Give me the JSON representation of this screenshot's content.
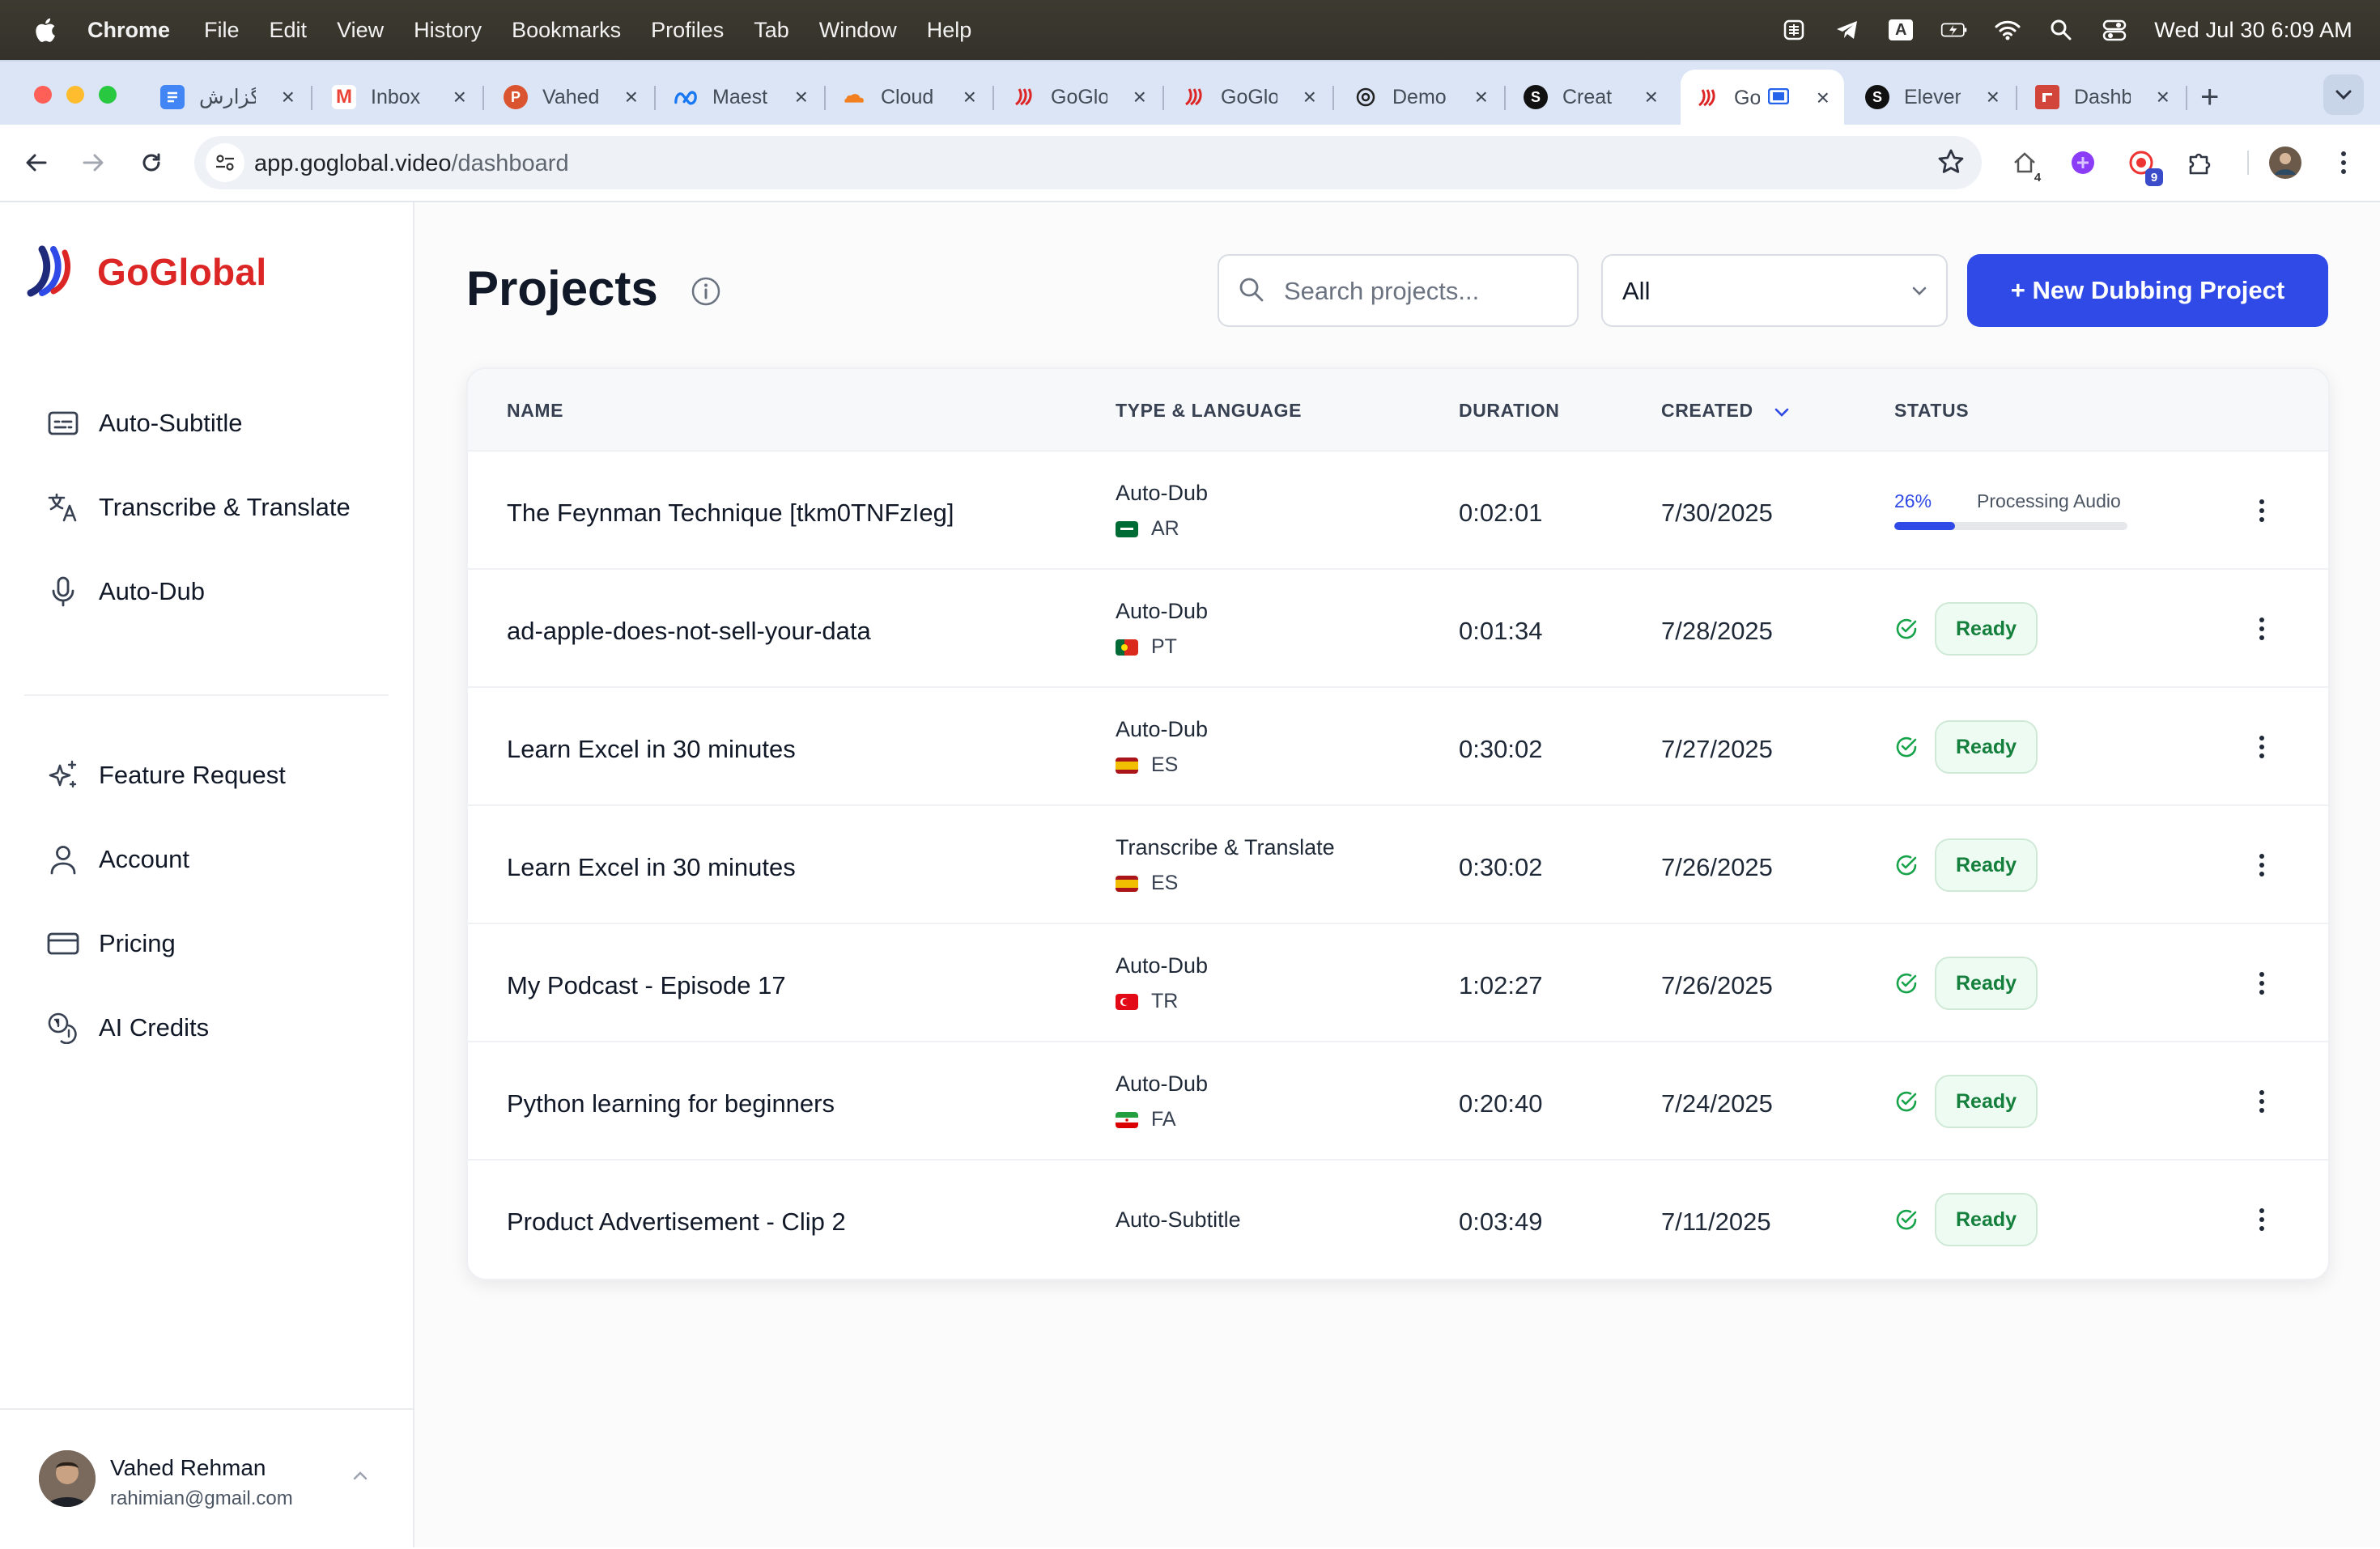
{
  "menubar": {
    "app": "Chrome",
    "menus": [
      "File",
      "Edit",
      "View",
      "History",
      "Bookmarks",
      "Profiles",
      "Tab",
      "Window",
      "Help"
    ],
    "clock": "Wed Jul 30  6:09 AM",
    "input_source": "A"
  },
  "tabs": [
    {
      "title": "گزارش",
      "favicon": "docs-icon",
      "color": "#4285f4",
      "letter": ""
    },
    {
      "title": "Inbox",
      "favicon": "gmail-icon",
      "color": "#ea4335",
      "letter": "M"
    },
    {
      "title": "Vahed",
      "favicon": "producthunt-icon",
      "color": "#da552f",
      "letter": "P"
    },
    {
      "title": "Maest",
      "favicon": "meta-icon",
      "color": "#1877f2",
      "letter": ""
    },
    {
      "title": "Cloud",
      "favicon": "cloudflare-icon",
      "color": "#f38020",
      "letter": ""
    },
    {
      "title": "GoGlo",
      "favicon": "goglobal-icon",
      "color": "#dc2626",
      "letter": ""
    },
    {
      "title": "GoGlo",
      "favicon": "goglobal-icon",
      "color": "#dc2626",
      "letter": ""
    },
    {
      "title": "Demo",
      "favicon": "openai-icon",
      "color": "#111111",
      "letter": ""
    },
    {
      "title": "Creat",
      "favicon": "s-icon",
      "color": "#111111",
      "letter": "S"
    },
    {
      "title": "Go",
      "favicon": "goglobal-icon",
      "color": "#dc2626",
      "letter": ""
    },
    {
      "title": "Eleven",
      "favicon": "s-icon",
      "color": "#111111",
      "letter": "S"
    },
    {
      "title": "Dashb",
      "favicon": "dashboard-icon",
      "color": "#d1453b",
      "letter": ""
    }
  ],
  "toolbar": {
    "url_host": "app.goglobal.video",
    "url_path": "/dashboard",
    "ext_badge_1": "4",
    "ext_badge_2": "9"
  },
  "sidebar": {
    "brand": "GoGlobal",
    "items_top": [
      {
        "label": "Auto-Subtitle",
        "icon": "subtitles-icon"
      },
      {
        "label": "Transcribe & Translate",
        "icon": "translate-icon"
      },
      {
        "label": "Auto-Dub",
        "icon": "microphone-icon"
      }
    ],
    "items_bottom": [
      {
        "label": "Feature Request",
        "icon": "sparkles-icon"
      },
      {
        "label": "Account",
        "icon": "user-icon"
      },
      {
        "label": "Pricing",
        "icon": "credit-card-icon"
      },
      {
        "label": "AI Credits",
        "icon": "coins-icon"
      }
    ],
    "user": {
      "name": "Vahed Rehman",
      "email": "rahimian@gmail.com"
    }
  },
  "main": {
    "title": "Projects",
    "search_placeholder": "Search projects...",
    "filter_value": "All",
    "new_button": "+ New Dubbing Project"
  },
  "table": {
    "headers": {
      "name": "NAME",
      "type": "TYPE & LANGUAGE",
      "duration": "DURATION",
      "created": "CREATED",
      "status": "STATUS"
    },
    "rows": [
      {
        "name": "The Feynman Technique [tkm0TNFzIeg]",
        "type": "Auto-Dub",
        "lang": "AR",
        "flag": "sa",
        "duration": "0:02:01",
        "created": "7/30/2025",
        "status": "progress",
        "progress_pct": "26%",
        "progress_value": 0.26,
        "progress_text": "Processing Audio"
      },
      {
        "name": "ad-apple-does-not-sell-your-data",
        "type": "Auto-Dub",
        "lang": "PT",
        "flag": "pt",
        "duration": "0:01:34",
        "created": "7/28/2025",
        "status": "Ready"
      },
      {
        "name": "Learn Excel in 30 minutes",
        "type": "Auto-Dub",
        "lang": "ES",
        "flag": "es",
        "duration": "0:30:02",
        "created": "7/27/2025",
        "status": "Ready"
      },
      {
        "name": "Learn Excel in 30 minutes",
        "type": "Transcribe & Translate",
        "lang": "ES",
        "flag": "es",
        "duration": "0:30:02",
        "created": "7/26/2025",
        "status": "Ready"
      },
      {
        "name": "My Podcast - Episode 17",
        "type": "Auto-Dub",
        "lang": "TR",
        "flag": "tr",
        "duration": "1:02:27",
        "created": "7/26/2025",
        "status": "Ready"
      },
      {
        "name": "Python learning for beginners",
        "type": "Auto-Dub",
        "lang": "FA",
        "flag": "ir",
        "duration": "0:20:40",
        "created": "7/24/2025",
        "status": "Ready"
      },
      {
        "name": "Product Advertisement - Clip 2",
        "type": "Auto-Subtitle",
        "lang": "",
        "flag": "",
        "duration": "0:03:49",
        "created": "7/11/2025",
        "status": "Ready"
      }
    ]
  },
  "colors": {
    "brand": "#dc2626",
    "accent": "#2f4ae6",
    "ready": "#15803d"
  }
}
